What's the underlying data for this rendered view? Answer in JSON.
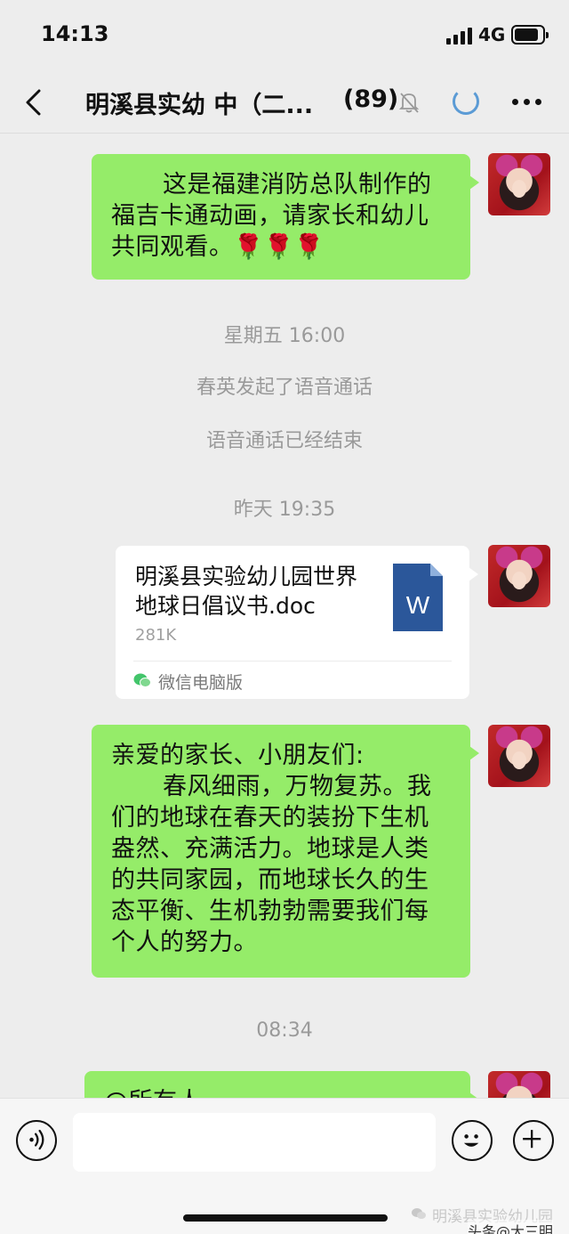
{
  "status_bar": {
    "time": "14:13",
    "network": "4G"
  },
  "header": {
    "title": "明溪县实幼 中（二...",
    "member_count": "(89)"
  },
  "messages": [
    {
      "type": "text",
      "lines": [
        "这是福建消防总队制作的",
        "福吉卡通动画，请家长和幼儿",
        "共同观看。🌹🌹🌹"
      ]
    },
    {
      "type": "system",
      "text": "星期五 16:00"
    },
    {
      "type": "system",
      "text": "春英发起了语音通话"
    },
    {
      "type": "system",
      "text": "语音通话已经结束"
    },
    {
      "type": "system",
      "text": "昨天 19:35"
    },
    {
      "type": "file",
      "name": "明溪县实验幼儿园世界地球日倡议书.doc",
      "size": "281K",
      "icon_letter": "W",
      "source": "微信电脑版"
    },
    {
      "type": "text",
      "lines": [
        "亲爱的家长、小朋友们:",
        "春风细雨，万物复苏。我",
        "们的地球在春天的装扮下生机",
        "盎然、充满活力。地球是人类",
        "的共同家园，而地球长久的生",
        "态平衡、生机勃勃需要我们每",
        "个人的努力。"
      ]
    },
    {
      "type": "system",
      "text": "08:34"
    },
    {
      "type": "text",
      "lines": [
        "@所有人"
      ]
    }
  ],
  "input_bar": {
    "placeholder": ""
  },
  "watermark": {
    "account": "明溪县实验幼儿园",
    "source": "头条@大三明"
  },
  "colors": {
    "own_bubble": "#95ec69",
    "background": "#ededed",
    "system_text": "#9a9a9a",
    "word_blue": "#2b579a"
  },
  "icons": {
    "back": "chevron-left-icon",
    "mute": "bell-off-icon",
    "loading": "spinner-icon",
    "more": "more-dots-icon",
    "voice": "voice-icon",
    "emoji": "emoji-icon",
    "add": "plus-icon",
    "file": "word-doc-icon"
  }
}
